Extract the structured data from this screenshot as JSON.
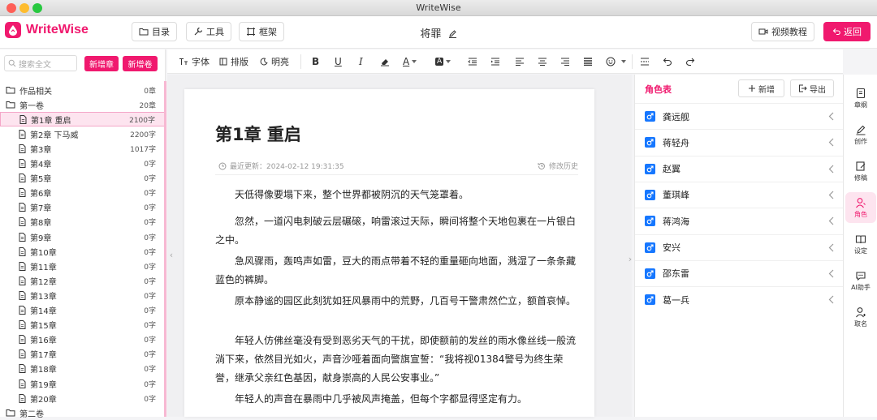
{
  "window": {
    "title": "WriteWise"
  },
  "header": {
    "brand": "WriteWise",
    "btn_catalog": "目录",
    "btn_tools": "工具",
    "btn_frame": "框架",
    "doc_name": "将罪",
    "btn_video": "视频教程",
    "btn_back": "返回"
  },
  "toolbar": {
    "font": "字体",
    "layout": "排版",
    "brightness": "明亮"
  },
  "sidebar": {
    "search_placeholder": "搜索全文",
    "btn_add_chapter": "新增章",
    "btn_add_volume": "新增卷",
    "folders": [
      {
        "label": "作品相关",
        "count": "0章"
      },
      {
        "label": "第一卷",
        "count": "20章"
      }
    ],
    "chapters": [
      {
        "label": "第1章 重启",
        "count": "2100字"
      },
      {
        "label": "第2章 下马威",
        "count": "2200字"
      },
      {
        "label": "第3章",
        "count": "1017字"
      },
      {
        "label": "第4章",
        "count": "0字"
      },
      {
        "label": "第5章",
        "count": "0字"
      },
      {
        "label": "第6章",
        "count": "0字"
      },
      {
        "label": "第7章",
        "count": "0字"
      },
      {
        "label": "第8章",
        "count": "0字"
      },
      {
        "label": "第9章",
        "count": "0字"
      },
      {
        "label": "第10章",
        "count": "0字"
      },
      {
        "label": "第11章",
        "count": "0字"
      },
      {
        "label": "第12章",
        "count": "0字"
      },
      {
        "label": "第13章",
        "count": "0字"
      },
      {
        "label": "第14章",
        "count": "0字"
      },
      {
        "label": "第15章",
        "count": "0字"
      },
      {
        "label": "第16章",
        "count": "0字"
      },
      {
        "label": "第17章",
        "count": "0字"
      },
      {
        "label": "第18章",
        "count": "0字"
      },
      {
        "label": "第19章",
        "count": "0字"
      },
      {
        "label": "第20章",
        "count": "0字"
      }
    ],
    "next_volume": "第二卷"
  },
  "editor": {
    "title": "第1章 重启",
    "updated": "最近更新：2024-02-12 19:31:35",
    "history": "修改历史",
    "paragraphs": [
      "天低得像要塌下来，整个世界都被阴沉的天气笼罩着。",
      "忽然，一道闪电刺破云层碾磙，响雷滚过天际，瞬间将整个天地包裹在一片银白之中。",
      "急风骤雨，轰鸣声如雷，豆大的雨点带着不轻的重量砸向地面，溅湿了一条条藏蓝色的裤脚。",
      "原本静谧的园区此刻犹如狂风暴雨中的荒野，几百号干警肃然伫立，额首哀悼。",
      "年轻人仿佛丝毫没有受到恶劣天气的干扰，即使额前的发丝的雨水像丝线一般流淌下来，依然目光如火，声音沙哑着面向警旗宣誓：“我将视01384警号为终生荣誉，继承父亲红色基因，献身崇高的人民公安事业。”",
      "年轻人的声音在暴雨中几乎被风声掩盖，但每个字都显得坚定有力。"
    ]
  },
  "characters": {
    "title": "角色表",
    "btn_add": "新增",
    "btn_export": "导出",
    "list": [
      "龚远舰",
      "蒋轻舟",
      "赵翼",
      "董琪峰",
      "蒋鸿海",
      "安兴",
      "邵东雷",
      "葛一兵"
    ]
  },
  "rail": [
    {
      "label": "章纲",
      "icon": "outline-icon"
    },
    {
      "label": "创作",
      "icon": "pen-icon"
    },
    {
      "label": "修稿",
      "icon": "edit-icon"
    },
    {
      "label": "角色",
      "icon": "person-icon"
    },
    {
      "label": "设定",
      "icon": "book-icon"
    },
    {
      "label": "AI助手",
      "icon": "chat-icon"
    },
    {
      "label": "取名",
      "icon": "name-icon"
    }
  ],
  "colors": {
    "accent": "#f0196e",
    "male_badge": "#1677ff"
  }
}
